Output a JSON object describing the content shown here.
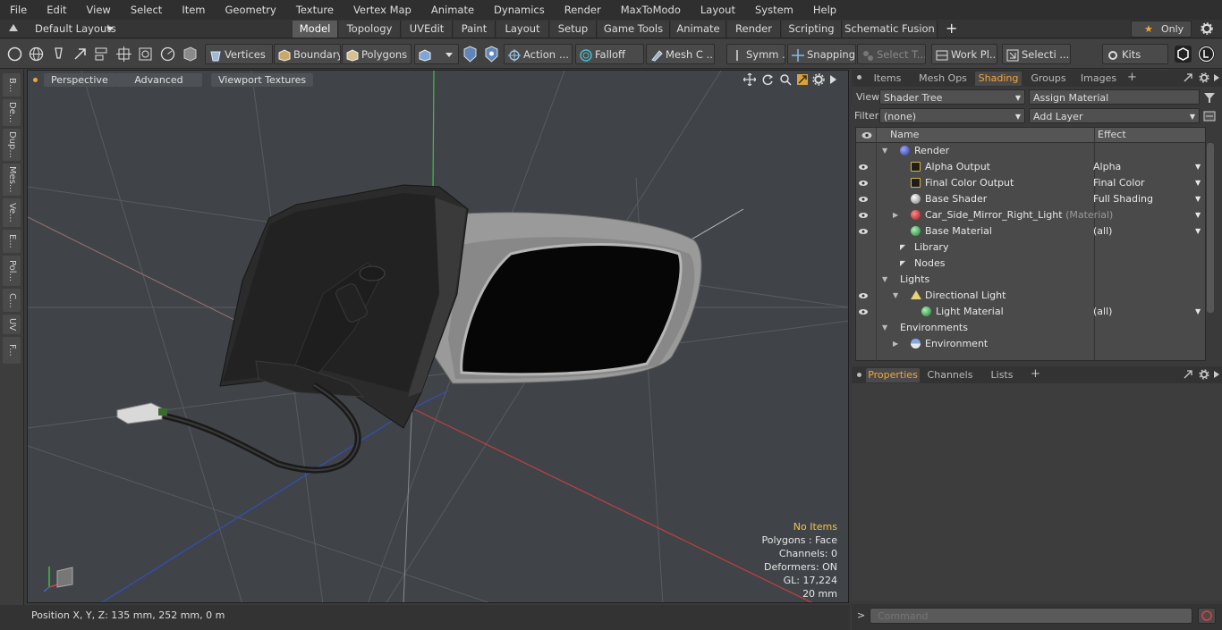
{
  "menu": [
    "File",
    "Edit",
    "View",
    "Select",
    "Item",
    "Geometry",
    "Texture",
    "Vertex Map",
    "Animate",
    "Dynamics",
    "Render",
    "MaxToModo",
    "Layout",
    "System",
    "Help"
  ],
  "layout_bar": {
    "layout_select": "Default Layouts",
    "tabs": [
      "Model",
      "Topology",
      "UVEdit",
      "Paint",
      "Layout",
      "Setup",
      "Game Tools",
      "Animate",
      "Render",
      "Scripting",
      "Schematic Fusion"
    ],
    "active_tab": "Model",
    "add": "+",
    "only_label": "Only",
    "star": "★"
  },
  "toolbar": {
    "vertices": "Vertices",
    "boundary": "Boundary",
    "polygons": "Polygons",
    "action": "Action",
    "falloff": "Falloff",
    "mesh": "Mesh C ...",
    "symm": "Symm ...",
    "snapping": "Snapping",
    "select_t": "Select T...",
    "work_pl": "Work Pl...",
    "selecti": "Selecti ...",
    "kits": "Kits",
    "action_more": "..."
  },
  "left_strip": [
    "B...",
    "De...",
    "Dup...",
    "Mes...",
    "Ve...",
    "E...",
    "Pol...",
    "C...",
    "UV",
    "F..."
  ],
  "viewport": {
    "perspective": "Perspective",
    "advanced": "Advanced",
    "textures": "Viewport Textures",
    "info": {
      "no_items": "No Items",
      "polygons": "Polygons : Face",
      "channels": "Channels: 0",
      "deformers": "Deformers: ON",
      "gl": "GL: 17,224",
      "size": "20 mm"
    }
  },
  "status": {
    "position": "Position X, Y, Z:   135 mm, 252 mm, 0 m"
  },
  "shader_panel": {
    "tabs": [
      "Items",
      "Mesh Ops",
      "Shading",
      "Groups",
      "Images"
    ],
    "active_tab": "Shading",
    "add": "+",
    "view_label": "View",
    "view_value": "Shader Tree",
    "assign_material": "Assign Material",
    "filter_label": "Filter",
    "filter_value": "(none)",
    "add_layer": "Add Layer",
    "col_name": "Name",
    "col_effect": "Effect",
    "rows": [
      {
        "name": "Render",
        "effect": "",
        "suffix": ""
      },
      {
        "name": "Alpha Output",
        "effect": "Alpha",
        "suffix": ""
      },
      {
        "name": "Final Color Output",
        "effect": "Final Color",
        "suffix": ""
      },
      {
        "name": "Base Shader",
        "effect": "Full Shading",
        "suffix": ""
      },
      {
        "name": "Car_Side_Mirror_Right_Light",
        "effect": "",
        "suffix": "(Material)"
      },
      {
        "name": "Base Material",
        "effect": "(all)",
        "suffix": ""
      },
      {
        "name": "Library",
        "effect": "",
        "suffix": ""
      },
      {
        "name": "Nodes",
        "effect": "",
        "suffix": ""
      },
      {
        "name": "Lights",
        "effect": "",
        "suffix": ""
      },
      {
        "name": "Directional Light",
        "effect": "",
        "suffix": ""
      },
      {
        "name": "Light Material",
        "effect": "(all)",
        "suffix": ""
      },
      {
        "name": "Environments",
        "effect": "",
        "suffix": ""
      },
      {
        "name": "Environment",
        "effect": "",
        "suffix": ""
      }
    ]
  },
  "properties_panel": {
    "tabs": [
      "Properties",
      "Channels",
      "Lists"
    ],
    "active_tab": "Properties",
    "add": "+"
  },
  "command": {
    "placeholder": "Command",
    "prompt": ">"
  },
  "colors": {
    "accent": "#f3a43a",
    "viewport_bg": "#404448"
  }
}
